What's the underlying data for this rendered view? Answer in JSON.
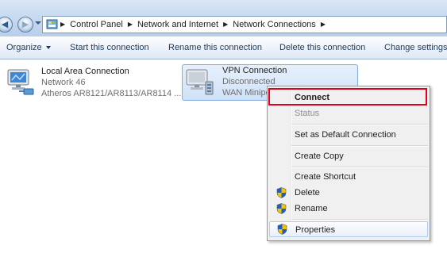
{
  "breadcrumb": {
    "items": [
      "Control Panel",
      "Network and Internet",
      "Network Connections"
    ]
  },
  "commands": {
    "organize": "Organize",
    "start": "Start this connection",
    "rename": "Rename this connection",
    "delete": "Delete this connection",
    "change": "Change settings"
  },
  "items": [
    {
      "name": "Local Area Connection",
      "network": "Network  46",
      "adapter": "Atheros AR8121/AR8113/AR8114 ..."
    },
    {
      "name": "VPN Connection",
      "status": "Disconnected",
      "adapter": "WAN Minipo"
    }
  ],
  "context_menu": {
    "connect": "Connect",
    "status": "Status",
    "set_default": "Set as Default Connection",
    "create_copy": "Create Copy",
    "create_shortcut": "Create Shortcut",
    "delete": "Delete",
    "rename": "Rename",
    "properties": "Properties"
  },
  "colors": {
    "highlight": "#e0001b",
    "selection": "#cfe2f8"
  },
  "icons": {
    "back": "back-arrow-icon",
    "forward": "forward-arrow-icon",
    "network_adapter": "network-adapter-icon",
    "vpn": "vpn-connection-icon",
    "uac": "uac-shield-icon"
  }
}
